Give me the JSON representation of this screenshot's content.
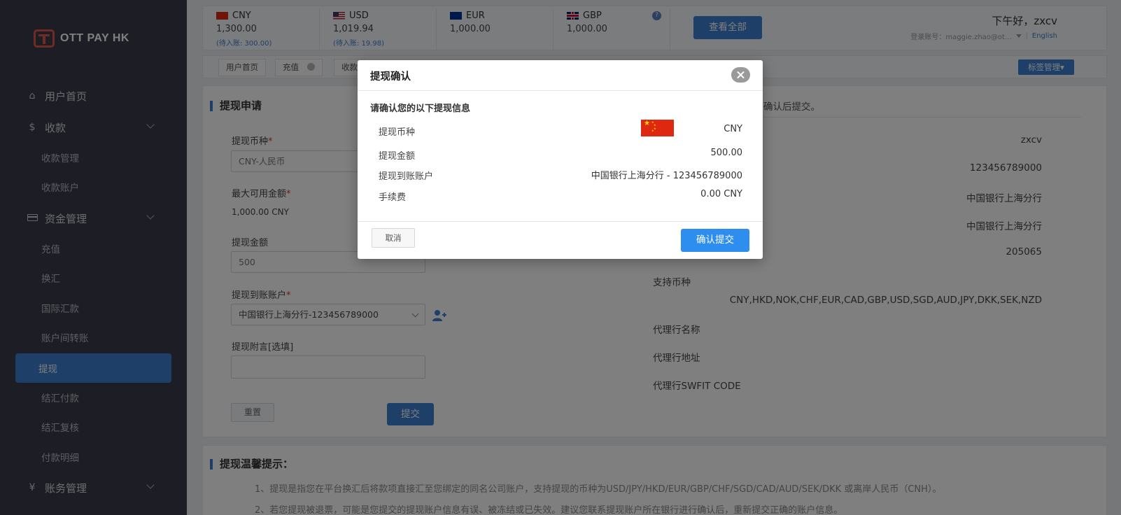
{
  "sidebar": {
    "logo": "OTT PAY HK",
    "items": [
      {
        "label": "用户首页"
      },
      {
        "label": "收款"
      },
      {
        "label": "收款管理"
      },
      {
        "label": "收款账户"
      },
      {
        "label": "资金管理"
      },
      {
        "label": "充值"
      },
      {
        "label": "换汇"
      },
      {
        "label": "国际汇款"
      },
      {
        "label": "账户间转账"
      },
      {
        "label": "提现"
      },
      {
        "label": "结汇付款"
      },
      {
        "label": "结汇复核"
      },
      {
        "label": "付款明细"
      },
      {
        "label": "账务管理"
      }
    ]
  },
  "balances": [
    {
      "code": "CNY",
      "amount": "1,300.00",
      "pending": "(待入账: 300.00)"
    },
    {
      "code": "USD",
      "amount": "1,019.94",
      "pending": "(待入账: 19.98)"
    },
    {
      "code": "EUR",
      "amount": "1,000.00",
      "pending": ""
    },
    {
      "code": "GBP",
      "amount": "1,000.00",
      "pending": ""
    }
  ],
  "header": {
    "view_all": "查看全部",
    "greeting": "下午好，zxcv",
    "login_label": "登录账号：maggie.zhao@ot...",
    "language": "English",
    "help": "?"
  },
  "tabs": {
    "items": [
      "用户首页",
      "充值",
      "收款"
    ],
    "tag_manage": "标签管理▾"
  },
  "form": {
    "section_title": "提现申请",
    "currency_label": "提现币种",
    "currency_value": "CNY-人民币",
    "max_label": "最大可用金额",
    "max_value": "1,000.00 CNY",
    "amount_label": "提现金额",
    "amount_value": "500",
    "account_label": "提现到账账户",
    "account_value": "中国银行上海分行-123456789000",
    "memo_label": "提现附言[选填]",
    "required_mark": "*",
    "reset": "重置",
    "submit": "提交"
  },
  "account_info": {
    "hint": "确认后提交。",
    "values": [
      "zxcv",
      "123456789000",
      "中国银行上海分行",
      "中国银行上海分行",
      "205065"
    ],
    "support_label": "支持币种",
    "support_value": "CNY,HKD,NOK,CHF,EUR,CAD,GBP,USD,SGD,AUD,JPY,DKK,SEK,NZD",
    "agent_name_label": "代理行名称",
    "agent_addr_label": "代理行地址",
    "agent_swift_label": "代理行SWFIT CODE"
  },
  "tips": {
    "title": "提现温馨提示：",
    "lines": [
      "1、提现是指您在平台换汇后将款项直接汇至您绑定的同名公司账户，支持提现的币种为USD/JPY/HKD/EUR/GBP/CHF/SGD/CAD/AUD/SEK/DKK 或离岸人民币（CNH）。",
      "2、若您提现被退票，可能是您提交的提现账户信息有误、被冻结或已失效。建议您联系提现账户所在银行进行确认后，重新提交正确的账户信息。"
    ]
  },
  "modal": {
    "title": "提现确认",
    "subtitle": "请确认您的以下提现信息",
    "rows": [
      {
        "label": "提现币种",
        "value": "CNY"
      },
      {
        "label": "提现金额",
        "value": "500.00"
      },
      {
        "label": "提现到账账户",
        "value": "中国银行上海分行 - 123456789000"
      },
      {
        "label": "手续费",
        "value": "0.00 CNY"
      }
    ],
    "cancel": "取消",
    "confirm": "确认提交"
  },
  "colors": {
    "sidebar_bg": "#3a3d4a",
    "accent": "#3d7fd0",
    "confirm": "#2e8ef0",
    "required": "#d9362c"
  }
}
